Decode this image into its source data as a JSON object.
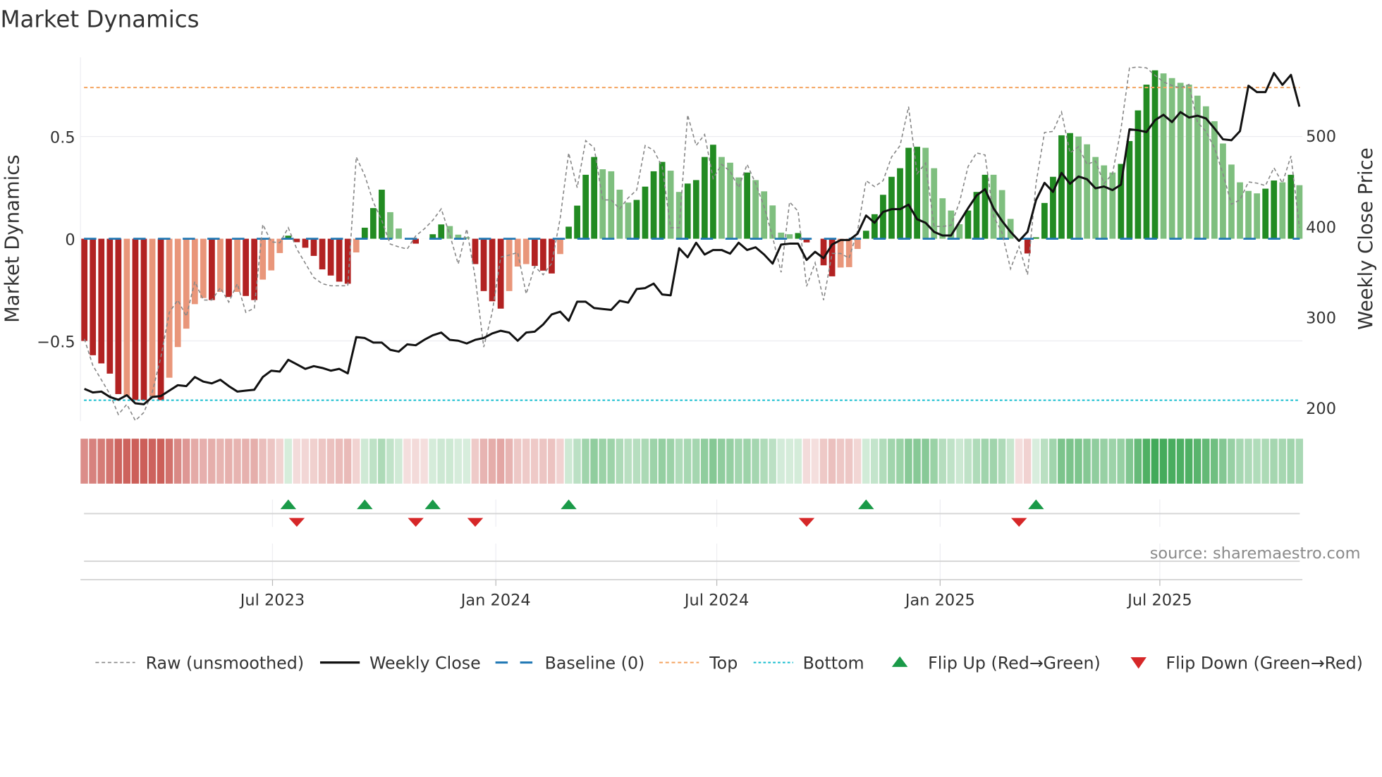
{
  "title": "Market Dynamics",
  "source_note": "source: sharemaestro.com",
  "chart_data": {
    "type": "bar",
    "title": "Market Dynamics",
    "frequency": "weekly",
    "start_date": "2023-01-27",
    "ylabel_left": "Market Dynamics",
    "ylabel_right": "Weekly Close Price",
    "ylim_left": [
      -0.89,
      0.89
    ],
    "ylim_right": [
      186,
      586
    ],
    "left_ticks": [
      {
        "v": 0.5,
        "label": "0.5"
      },
      {
        "v": 0,
        "label": "0"
      },
      {
        "v": -0.5,
        "label": "−0.5"
      }
    ],
    "right_ticks": [
      {
        "v": 500,
        "label": "500"
      },
      {
        "v": 400,
        "label": "400"
      },
      {
        "v": 300,
        "label": "300"
      },
      {
        "v": 200,
        "label": "200"
      }
    ],
    "x_ticks": [
      {
        "date": "2023-07-01",
        "label": "Jul 2023"
      },
      {
        "date": "2024-01-01",
        "label": "Jan 2024"
      },
      {
        "date": "2024-07-01",
        "label": "Jul 2024"
      },
      {
        "date": "2025-01-01",
        "label": "Jan 2025"
      },
      {
        "date": "2025-07-01",
        "label": "Jul 2025"
      }
    ],
    "top_level": 0.74,
    "bottom_level": -0.79,
    "baseline": 0,
    "dynamics": [
      -0.5,
      -0.57,
      -0.61,
      -0.66,
      -0.76,
      -0.77,
      -0.79,
      -0.79,
      -0.77,
      -0.79,
      -0.68,
      -0.53,
      -0.44,
      -0.32,
      -0.29,
      -0.3,
      -0.26,
      -0.285,
      -0.26,
      -0.28,
      -0.3,
      -0.2,
      -0.155,
      -0.07,
      0.015,
      -0.017,
      -0.044,
      -0.084,
      -0.15,
      -0.18,
      -0.21,
      -0.22,
      -0.067,
      0.054,
      0.15,
      0.24,
      0.13,
      0.05,
      0,
      -0.024,
      0,
      0.022,
      0.07,
      0.062,
      0.02,
      0.008,
      -0.124,
      -0.256,
      -0.306,
      -0.342,
      -0.256,
      -0.136,
      -0.124,
      -0.133,
      -0.156,
      -0.17,
      -0.075,
      0.059,
      0.162,
      0.313,
      0.4,
      0.34,
      0.33,
      0.24,
      0.177,
      0.19,
      0.255,
      0.33,
      0.376,
      0.333,
      0.229,
      0.27,
      0.287,
      0.4,
      0.46,
      0.4,
      0.372,
      0.3,
      0.324,
      0.287,
      0.232,
      0.163,
      0.03,
      0.022,
      0.028,
      -0.018,
      0,
      -0.13,
      -0.184,
      -0.141,
      -0.139,
      -0.05,
      0.039,
      0.12,
      0.215,
      0.303,
      0.345,
      0.445,
      0.45,
      0.445,
      0.345,
      0.198,
      0.138,
      0.071,
      0.138,
      0.229,
      0.313,
      0.313,
      0.238,
      0.097,
      0,
      -0.072,
      0.007,
      0.175,
      0.303,
      0.506,
      0.517,
      0.5,
      0.462,
      0.4,
      0.359,
      0.324,
      0.366,
      0.478,
      0.628,
      0.754,
      0.824,
      0.809,
      0.786,
      0.763,
      0.754,
      0.7,
      0.648,
      0.575,
      0.466,
      0.363,
      0.276,
      0.234,
      0.222,
      0.245,
      0.285,
      0.276,
      0.313,
      0.262
    ],
    "shade": "DDDDDLDDLDLLLLLDLDLDDLLLDDDDDDDDLDDDLLLDDDDLLLDDDDLLLDDDLDDDDLLLLDDDDLLDDDDLLLDLLLLLDDDDDLLLDDDDDDDLLLLLDDDLLLLDDDDDDLLLLLDDDDDLLLLLLLLLLLLDDLDL",
    "raw": [
      -0.49,
      -0.62,
      -0.69,
      -0.76,
      -0.86,
      -0.81,
      -0.89,
      -0.85,
      -0.75,
      -0.58,
      -0.36,
      -0.3,
      -0.38,
      -0.21,
      -0.3,
      -0.3,
      -0.24,
      -0.31,
      -0.22,
      -0.36,
      -0.34,
      0.07,
      -0.015,
      -0.02,
      0.054,
      -0.05,
      -0.12,
      -0.19,
      -0.22,
      -0.23,
      -0.23,
      -0.23,
      0.4,
      0.31,
      0.18,
      0.09,
      -0.026,
      -0.04,
      -0.05,
      0.014,
      0.048,
      0.09,
      0.146,
      0.02,
      -0.124,
      0.048,
      -0.19,
      -0.53,
      -0.36,
      -0.09,
      -0.08,
      -0.067,
      -0.27,
      -0.136,
      -0.176,
      -0.12,
      0.1,
      0.42,
      0.25,
      0.48,
      0.445,
      0.19,
      0.19,
      0.146,
      0.2,
      0.238,
      0.456,
      0.433,
      0.353,
      0.054,
      0.054,
      0.606,
      0.456,
      0.51,
      0.295,
      0.364,
      0.33,
      0.25,
      0.364,
      0.27,
      0.157,
      0.008,
      -0.164,
      0.18,
      0.134,
      -0.233,
      -0.118,
      -0.3,
      -0.072,
      -0.072,
      -0.095,
      0.04,
      0.284,
      0.255,
      0.284,
      0.4,
      0.456,
      0.646,
      0.318,
      0.37,
      0.06,
      0.06,
      0.066,
      0.18,
      0.353,
      0.42,
      0.41,
      0.11,
      0.03,
      -0.147,
      -0.038,
      -0.176,
      0.272,
      0.52,
      0.525,
      0.62,
      0.42,
      0.45,
      0.364,
      0.38,
      0.27,
      0.318,
      0.537,
      0.836,
      0.84,
      0.836,
      0.8,
      0.767,
      0.75,
      0.738,
      0.755,
      0.57,
      0.525,
      0.445,
      0.318,
      0.169,
      0.19,
      0.278,
      0.272,
      0.26,
      0.347,
      0.272,
      0.405,
      0.054
    ],
    "close": [
      221,
      217,
      218,
      212,
      209,
      214,
      205,
      204,
      212,
      213,
      219,
      225,
      224,
      234,
      229,
      227,
      231,
      224,
      218,
      219,
      220,
      234,
      241,
      240,
      253,
      248,
      243,
      246,
      244,
      241,
      243,
      238,
      278,
      277,
      272,
      272,
      264,
      262,
      270,
      269,
      275,
      280,
      283,
      275,
      274,
      271,
      275,
      277,
      282,
      285,
      283,
      274,
      283,
      284,
      292,
      303,
      306,
      296,
      317,
      317,
      310,
      309,
      308,
      318,
      316,
      331,
      332,
      337,
      325,
      324,
      376,
      366,
      382,
      369,
      374,
      374,
      370,
      382,
      374,
      377,
      369,
      359,
      380,
      381,
      381,
      363,
      372,
      365,
      380,
      385,
      385,
      392,
      412,
      404,
      416,
      419,
      419,
      424,
      408,
      404,
      394,
      390,
      390,
      405,
      420,
      434,
      441,
      420,
      406,
      394,
      384,
      394,
      429,
      448,
      438,
      459,
      447,
      455,
      452,
      442,
      444,
      440,
      446,
      507,
      506,
      504,
      517,
      523,
      515,
      526,
      520,
      522,
      519,
      508,
      496,
      495,
      505,
      555,
      548,
      548,
      569,
      556,
      567,
      532
    ],
    "flip_up_weeks": [
      25,
      34,
      42,
      58,
      93,
      113
    ],
    "flip_down_weeks": [
      26,
      40,
      47,
      86,
      111
    ],
    "colors": {
      "pos_strong": "#228b22",
      "pos_weak": "#7fbf7f",
      "neg_strong": "#b22222",
      "neg_weak": "#e9967a",
      "close": "#111111",
      "raw": "#888888",
      "baseline": "#1f77b4",
      "top": "#f4a460",
      "bottom": "#17becf",
      "flip_up": "#1a9a48",
      "flip_down": "#d62728"
    },
    "legend": [
      {
        "key": "raw",
        "label": "Raw (unsmoothed)"
      },
      {
        "key": "close",
        "label": "Weekly Close"
      },
      {
        "key": "baseline",
        "label": "Baseline (0)"
      },
      {
        "key": "top",
        "label": "Top"
      },
      {
        "key": "bottom",
        "label": "Bottom"
      },
      {
        "key": "flip_up",
        "label": "Flip Up (Red→Green)"
      },
      {
        "key": "flip_down",
        "label": "Flip Down (Green→Red)"
      }
    ],
    "legend_position": "bottom"
  }
}
